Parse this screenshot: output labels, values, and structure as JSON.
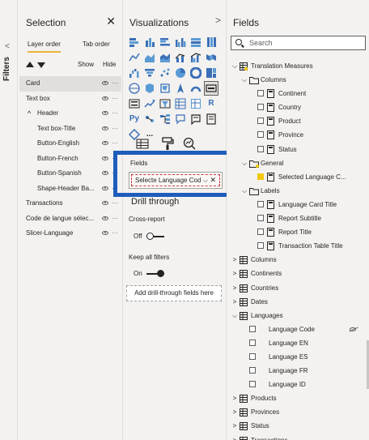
{
  "filters": {
    "label": "Filters"
  },
  "selection": {
    "title": "Selection",
    "tabs": [
      "Layer order",
      "Tab order"
    ],
    "show_label": "Show",
    "hide_label": "Hide",
    "items": [
      {
        "label": "Card",
        "level": 0,
        "selected": true
      },
      {
        "label": "Text box",
        "level": 0
      },
      {
        "label": "Header",
        "level": 0,
        "group": true
      },
      {
        "label": "Text box-Title",
        "level": 1
      },
      {
        "label": "Button-English",
        "level": 1
      },
      {
        "label": "Button-French",
        "level": 1
      },
      {
        "label": "Button-Spanish",
        "level": 1
      },
      {
        "label": "Shape-Header Ba...",
        "level": 1
      },
      {
        "label": "Transactions",
        "level": 0
      },
      {
        "label": "Code de langue sélec...",
        "level": 0
      },
      {
        "label": "Slicer-Language",
        "level": 0
      }
    ]
  },
  "visualizations": {
    "title": "Visualizations",
    "fields_label": "Fields",
    "field_chip": "Selecte Language Cod",
    "drill_title": "Drill through",
    "cross_report": "Cross-report",
    "toggle_off": "Off",
    "keep_filters": "Keep all filters",
    "toggle_on": "On",
    "drill_well": "Add drill-through fields here",
    "icons": [
      "stacked-bar",
      "stacked-column",
      "clustered-bar",
      "clustered-column",
      "100-bar",
      "100-column",
      "line",
      "area",
      "stacked-area",
      "line-column",
      "line-clustered",
      "ribbon",
      "waterfall",
      "funnel",
      "scatter",
      "pie",
      "donut",
      "treemap",
      "map",
      "filled-map",
      "shape-map",
      "azure-map",
      "gauge",
      "card",
      "multi-row-card",
      "kpi",
      "slicer",
      "table",
      "matrix",
      "r-visual",
      "python-visual",
      "key-influencers",
      "decomposition-tree",
      "qa",
      "smart-narrative",
      "paginated",
      "power-apps",
      "more"
    ],
    "icon_text": {
      "r-visual": "R",
      "python-visual": "Py",
      "more": "..."
    }
  },
  "fields": {
    "title": "Fields",
    "search_placeholder": "Search",
    "tree": [
      {
        "label": "Translation Measures",
        "indent": 0,
        "exp": "⌵",
        "kind": "table-y"
      },
      {
        "label": "Columns",
        "indent": 1,
        "exp": "⌵",
        "kind": "folder"
      },
      {
        "label": "Continent",
        "indent": 2,
        "kind": "field"
      },
      {
        "label": "Country",
        "indent": 2,
        "kind": "field"
      },
      {
        "label": "Product",
        "indent": 2,
        "kind": "field"
      },
      {
        "label": "Province",
        "indent": 2,
        "kind": "field"
      },
      {
        "label": "Status",
        "indent": 2,
        "kind": "field"
      },
      {
        "label": "General",
        "indent": 1,
        "exp": "⌵",
        "kind": "folder-y"
      },
      {
        "label": "Selected Language C...",
        "indent": 2,
        "kind": "field",
        "checked": true
      },
      {
        "label": "Labels",
        "indent": 1,
        "exp": "⌵",
        "kind": "folder"
      },
      {
        "label": "Language Card Title",
        "indent": 2,
        "kind": "field"
      },
      {
        "label": "Report Subtitle",
        "indent": 2,
        "kind": "field"
      },
      {
        "label": "Report Title",
        "indent": 2,
        "kind": "field"
      },
      {
        "label": "Transaction Table Title",
        "indent": 2,
        "kind": "field"
      },
      {
        "label": "Columns",
        "indent": 0,
        "exp": ">",
        "kind": "table"
      },
      {
        "label": "Continents",
        "indent": 0,
        "exp": ">",
        "kind": "table"
      },
      {
        "label": "Countries",
        "indent": 0,
        "exp": ">",
        "kind": "table"
      },
      {
        "label": "Dates",
        "indent": 0,
        "exp": ">",
        "kind": "table"
      },
      {
        "label": "Languages",
        "indent": 0,
        "exp": "⌵",
        "kind": "table"
      },
      {
        "label": "Language Code",
        "indent": 3,
        "kind": "plain",
        "hidden": true
      },
      {
        "label": "Language EN",
        "indent": 3,
        "kind": "plain"
      },
      {
        "label": "Language ES",
        "indent": 3,
        "kind": "plain"
      },
      {
        "label": "Language FR",
        "indent": 3,
        "kind": "plain"
      },
      {
        "label": "Language ID",
        "indent": 3,
        "kind": "plain"
      },
      {
        "label": "Products",
        "indent": 0,
        "exp": ">",
        "kind": "table"
      },
      {
        "label": "Provinces",
        "indent": 0,
        "exp": ">",
        "kind": "table"
      },
      {
        "label": "Status",
        "indent": 0,
        "exp": ">",
        "kind": "table"
      },
      {
        "label": "Transactions",
        "indent": 0,
        "exp": ">",
        "kind": "table"
      }
    ]
  },
  "colors": {
    "accent": "#1f5dbb",
    "checked": "#f2c811",
    "tab_underline": "#e8b43a"
  }
}
